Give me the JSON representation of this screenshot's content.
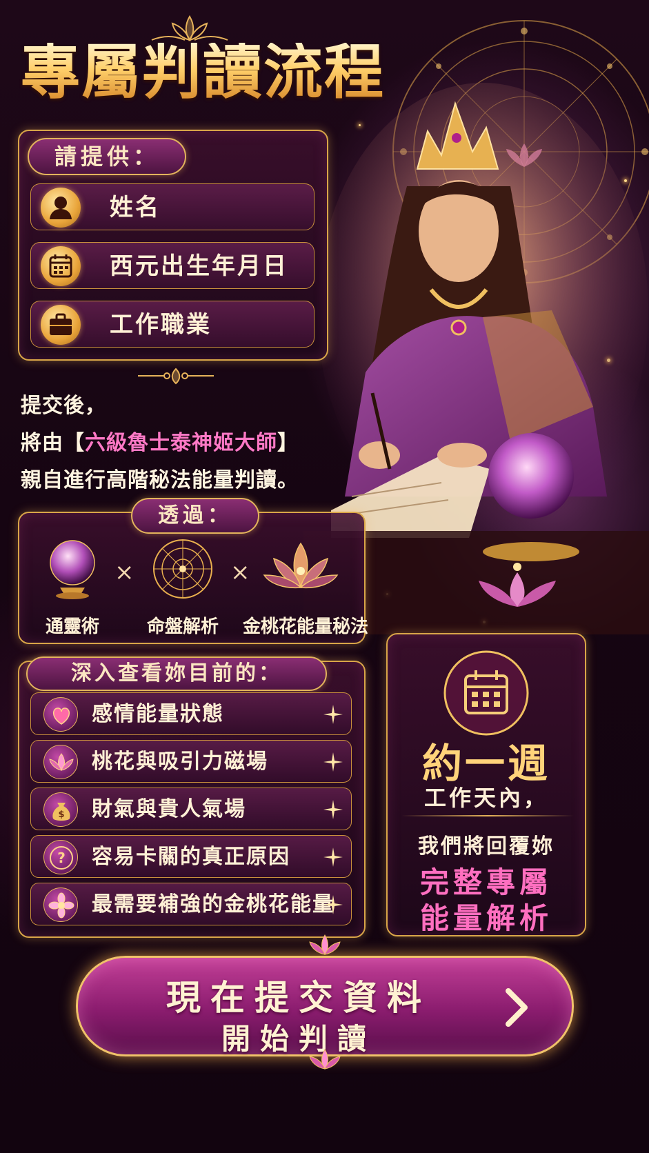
{
  "title": "專屬判讀流程",
  "provide": {
    "heading": "請提供：",
    "items": [
      {
        "icon": "person-icon",
        "label": "姓名"
      },
      {
        "icon": "calendar-icon",
        "label": "西元出生年月日"
      },
      {
        "icon": "briefcase-icon",
        "label": "工作職業"
      }
    ]
  },
  "intro": {
    "line1": "提交後，",
    "line2_pre": "將由【",
    "line2_highlight": "六級魯士泰神姬大師",
    "line2_post": "】",
    "line3": "親自進行高階秘法能量判讀。"
  },
  "through": {
    "heading": "透過：",
    "times": "×",
    "tools": [
      {
        "icon": "crystal-ball-icon",
        "label": "通靈術"
      },
      {
        "icon": "astrology-chart-icon",
        "label": "命盤解析"
      },
      {
        "icon": "lotus-icon",
        "label": "金桃花能量秘法"
      }
    ]
  },
  "aspects": {
    "heading": "深入查看妳目前的：",
    "items": [
      {
        "icon": "heart-icon",
        "label": "感情能量狀態"
      },
      {
        "icon": "lotus-icon",
        "label": "桃花與吸引力磁場"
      },
      {
        "icon": "money-bag-icon",
        "label": "財氣與貴人氣場"
      },
      {
        "icon": "question-icon",
        "label": "容易卡關的真正原因"
      },
      {
        "icon": "flower-icon",
        "label": "最需要補強的金桃花能量"
      }
    ]
  },
  "week": {
    "icon": "calendar-icon",
    "big": "約一週",
    "sub": "工作天內，",
    "reply": "我們將回覆妳",
    "pink1": "完整專屬",
    "pink2": "能量解析"
  },
  "cta": {
    "line1": "現在提交資料",
    "line2": "開始判讀",
    "icon": "chevron-right-icon"
  },
  "colors": {
    "gold": "#e3b45c",
    "pink": "#ff79c6",
    "purple": "#8a2e73"
  }
}
